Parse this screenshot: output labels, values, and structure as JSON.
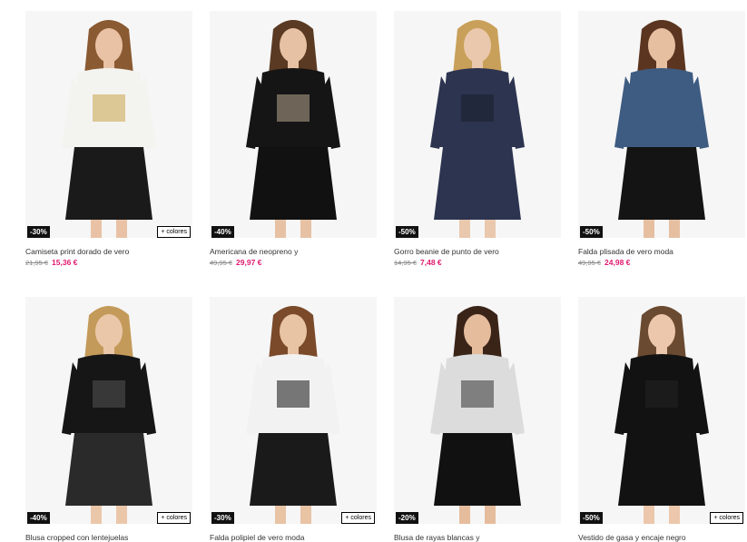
{
  "products": [
    {
      "discount": "-30%",
      "name": "Camiseta print dorado de vero",
      "old_price": "21,95 €",
      "new_price": "15,36 €",
      "colors_label": "+ colores",
      "palette": {
        "top": "#f3f3ef",
        "bottom": "#1a1a1a",
        "hair": "#8a5a32",
        "skin": "#e9c2a5",
        "accent": "#c9a448"
      }
    },
    {
      "discount": "-40%",
      "name": "Americana de neopreno y",
      "old_price": "49,95 €",
      "new_price": "29,97 €",
      "palette": {
        "top": "#151515",
        "bottom": "#111111",
        "hair": "#5a3a22",
        "skin": "#e7c1a3",
        "accent": "#b8a890"
      }
    },
    {
      "discount": "-50%",
      "name": "Gorro beanie de punto de vero",
      "old_price": "14,95 €",
      "new_price": "7,48 €",
      "palette": {
        "top": "#2c3450",
        "bottom": "#2c3450",
        "hair": "#c9a05a",
        "skin": "#eac8ad",
        "accent": "#1b1f2b"
      }
    },
    {
      "discount": "-50%",
      "name": "Falda plisada de vero moda",
      "old_price": "49,95 €",
      "new_price": "24,98 €",
      "palette": {
        "top": "#3e5c82",
        "bottom": "#141414",
        "hair": "#5b3520",
        "skin": "#e6bfa1",
        "accent": "#3e5c82"
      }
    },
    {
      "discount": "-40%",
      "name": "Blusa cropped con lentejuelas",
      "colors_label": "+ colores",
      "palette": {
        "top": "#161616",
        "bottom": "#2a2a2a",
        "hair": "#c49a5a",
        "skin": "#ebc7aa",
        "accent": "#555555"
      }
    },
    {
      "discount": "-30%",
      "name": "Falda polipiel de vero moda",
      "colors_label": "+ colores",
      "palette": {
        "top": "#f2f2f2",
        "bottom": "#1a1a1a",
        "hair": "#7a4a2a",
        "skin": "#e8c3a4",
        "accent": "#111111"
      }
    },
    {
      "discount": "-20%",
      "name": "Blusa de rayas blancas y",
      "palette": {
        "top": "#dcdcdc",
        "bottom": "#111111",
        "hair": "#3a2418",
        "skin": "#e5bc9c",
        "accent": "#333333"
      }
    },
    {
      "discount": "-50%",
      "name": "Vestido de gasa y encaje negro",
      "colors_label": "+ colores",
      "palette": {
        "top": "#121212",
        "bottom": "#121212",
        "hair": "#6a4a30",
        "skin": "#ecc7ab",
        "accent": "#222222"
      }
    }
  ]
}
